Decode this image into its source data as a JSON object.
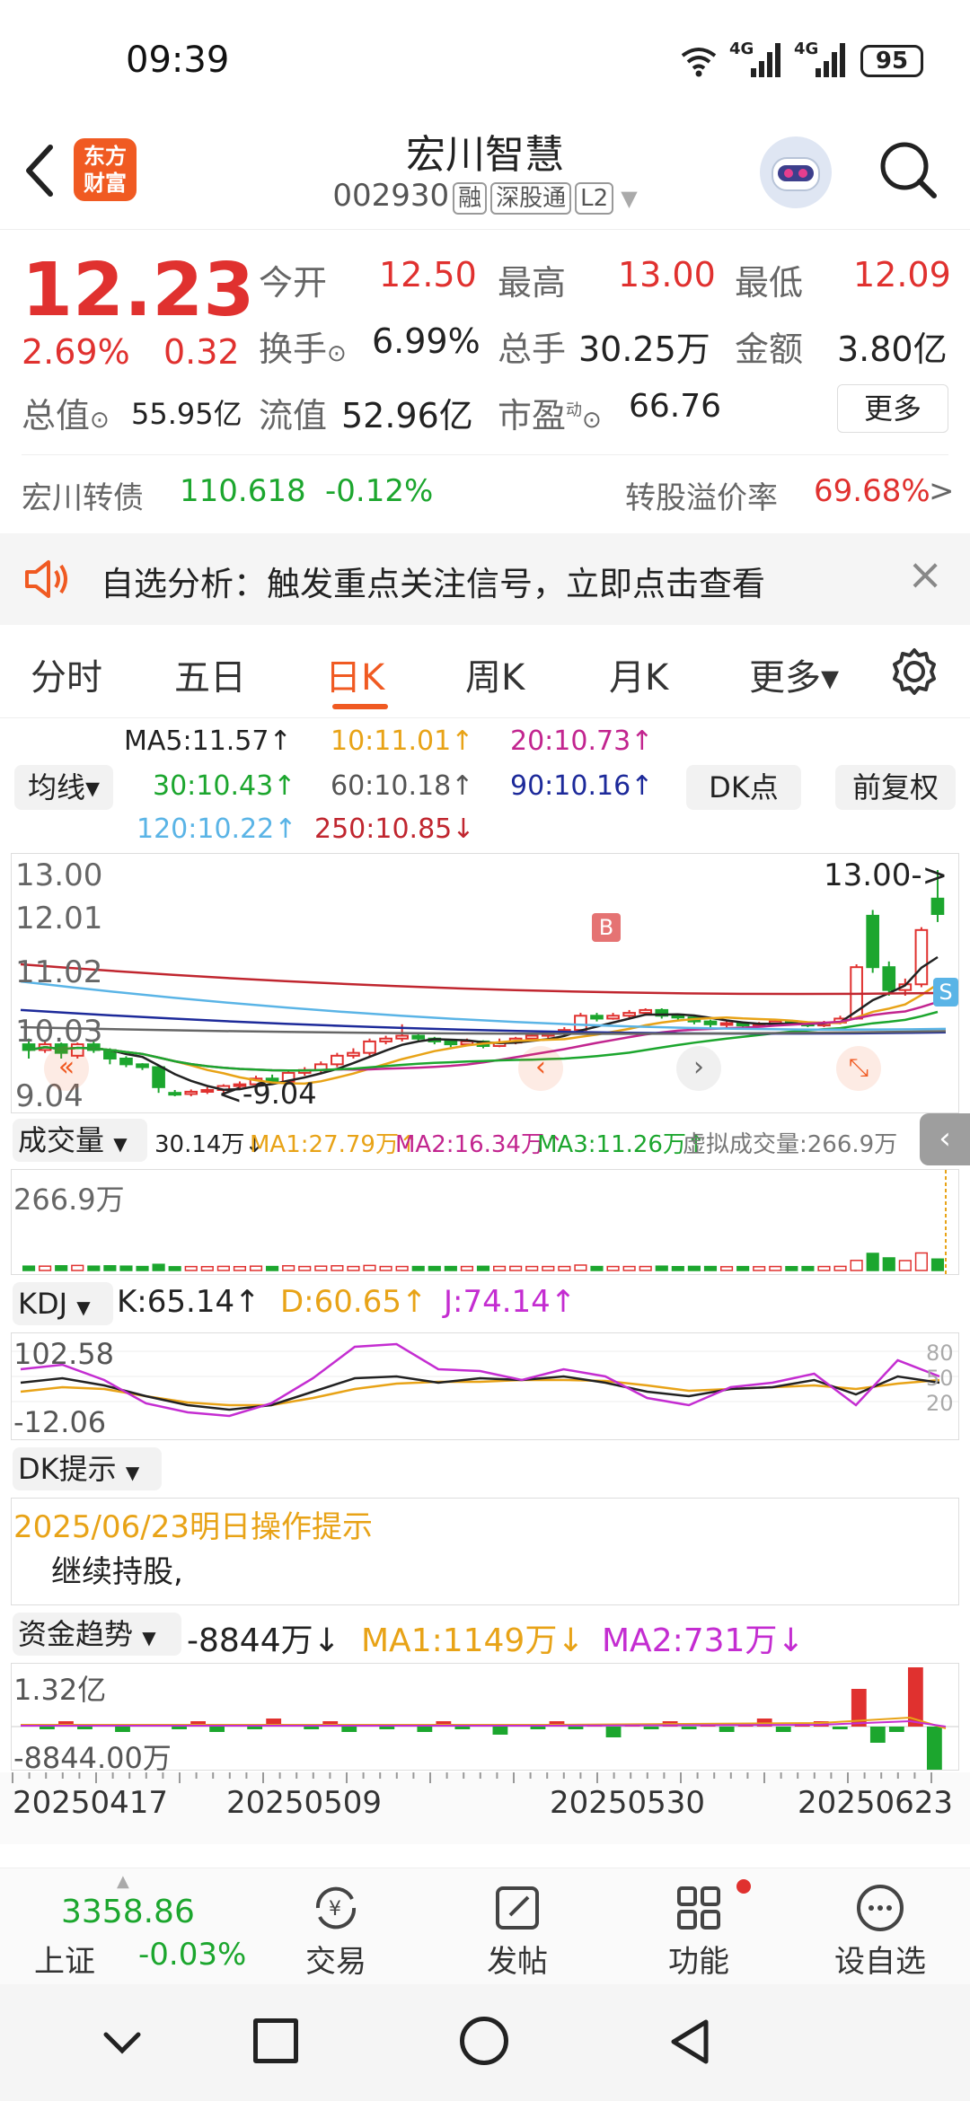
{
  "status": {
    "time": "09:39",
    "net1": "4G",
    "net2": "4G",
    "battery": "95"
  },
  "header": {
    "logo_line1": "东方",
    "logo_line2": "财富",
    "title": "宏川智慧",
    "code": "002930",
    "badges": [
      "融",
      "深股通",
      "L2"
    ]
  },
  "quote": {
    "price": "12.23",
    "pct": "2.69%",
    "chg": "0.32",
    "open_label": "今开",
    "open": "12.50",
    "high_label": "最高",
    "high": "13.00",
    "low_label": "最低",
    "low": "12.09",
    "turnover_label": "换手",
    "turnover": "6.99%",
    "volume_label": "总手",
    "volume": "30.25万",
    "amount_label": "金额",
    "amount": "3.80亿",
    "mcap_label": "总值",
    "mcap": "55.95亿",
    "float_label": "流值",
    "float": "52.96亿",
    "pe_label": "市盈",
    "pe_sup": "动",
    "pe": "66.76",
    "more_label": "更多"
  },
  "bond": {
    "name": "宏川转债",
    "price": "110.618",
    "pct": "-0.12%",
    "premium_label": "转股溢价率",
    "premium": "69.68%",
    "arrow": ">"
  },
  "notice": {
    "text": "自选分析：触发重点关注信号，立即点击查看",
    "close": "×"
  },
  "tabs": [
    "分时",
    "五日",
    "日K",
    "周K",
    "月K",
    "更多▾"
  ],
  "ma": {
    "selector": "均线▾",
    "ma5": "MA5:11.57↑",
    "ma10": "10:11.01↑",
    "ma20": "20:10.73↑",
    "ma30": "30:10.43↑",
    "ma60": "60:10.18↑",
    "ma90": "90:10.16↑",
    "ma120": "120:10.22↑",
    "ma250": "250:10.85↓",
    "dk": "DK点",
    "adj": "前复权",
    "colors": {
      "ma5": "#222222",
      "ma10": "#e8a317",
      "ma20": "#c2258f",
      "ma30": "#1ca62e",
      "ma60": "#666666",
      "ma90": "#1d2a9a",
      "ma120": "#5ab4e6",
      "ma250": "#c0262f"
    }
  },
  "kline": {
    "y_labels": [
      "13.00",
      "12.01",
      "11.02",
      "10.03",
      "9.04"
    ],
    "high_note": "13.00->",
    "low_note": "<-9.04",
    "b_marker": "B",
    "s_marker": "S",
    "candles": [
      {
        "o": 9.95,
        "c": 9.85,
        "h": 10.05,
        "l": 9.7
      },
      {
        "o": 9.85,
        "c": 9.95,
        "h": 10.0,
        "l": 9.8
      },
      {
        "o": 9.95,
        "c": 9.8,
        "h": 9.98,
        "l": 9.7
      },
      {
        "o": 9.75,
        "c": 9.95,
        "h": 9.98,
        "l": 9.7
      },
      {
        "o": 9.95,
        "c": 9.85,
        "h": 10.0,
        "l": 9.8
      },
      {
        "o": 9.85,
        "c": 9.7,
        "h": 9.88,
        "l": 9.6
      },
      {
        "o": 9.7,
        "c": 9.6,
        "h": 9.74,
        "l": 9.55
      },
      {
        "o": 9.6,
        "c": 9.55,
        "h": 9.62,
        "l": 9.5
      },
      {
        "o": 9.55,
        "c": 9.2,
        "h": 9.56,
        "l": 9.1
      },
      {
        "o": 9.1,
        "c": 9.08,
        "h": 9.15,
        "l": 9.04
      },
      {
        "o": 9.08,
        "c": 9.12,
        "h": 9.16,
        "l": 9.04
      },
      {
        "o": 9.12,
        "c": 9.15,
        "h": 9.2,
        "l": 9.08
      },
      {
        "o": 9.15,
        "c": 9.22,
        "h": 9.25,
        "l": 9.1
      },
      {
        "o": 9.22,
        "c": 9.25,
        "h": 9.3,
        "l": 9.18
      },
      {
        "o": 9.25,
        "c": 9.35,
        "h": 9.4,
        "l": 9.2
      },
      {
        "o": 9.35,
        "c": 9.3,
        "h": 9.42,
        "l": 9.25
      },
      {
        "o": 9.3,
        "c": 9.45,
        "h": 9.5,
        "l": 9.28
      },
      {
        "o": 9.45,
        "c": 9.5,
        "h": 9.55,
        "l": 9.4
      },
      {
        "o": 9.5,
        "c": 9.6,
        "h": 9.65,
        "l": 9.45
      },
      {
        "o": 9.6,
        "c": 9.75,
        "h": 9.8,
        "l": 9.55
      },
      {
        "o": 9.75,
        "c": 9.8,
        "h": 9.88,
        "l": 9.7
      },
      {
        "o": 9.8,
        "c": 10.0,
        "h": 10.05,
        "l": 9.75
      },
      {
        "o": 10.0,
        "c": 10.05,
        "h": 10.1,
        "l": 9.95
      },
      {
        "o": 10.05,
        "c": 10.1,
        "h": 10.3,
        "l": 10.0
      },
      {
        "o": 10.1,
        "c": 10.05,
        "h": 10.15,
        "l": 10.0
      },
      {
        "o": 10.05,
        "c": 10.0,
        "h": 10.08,
        "l": 9.95
      },
      {
        "o": 10.0,
        "c": 9.95,
        "h": 10.02,
        "l": 9.9
      },
      {
        "o": 9.95,
        "c": 10.0,
        "h": 10.05,
        "l": 9.92
      },
      {
        "o": 10.0,
        "c": 9.92,
        "h": 10.02,
        "l": 9.88
      },
      {
        "o": 9.92,
        "c": 9.98,
        "h": 10.05,
        "l": 9.9
      },
      {
        "o": 9.98,
        "c": 10.05,
        "h": 10.08,
        "l": 9.95
      },
      {
        "o": 10.05,
        "c": 10.1,
        "h": 10.12,
        "l": 10.0
      },
      {
        "o": 10.1,
        "c": 10.15,
        "h": 10.18,
        "l": 10.05
      },
      {
        "o": 10.15,
        "c": 10.2,
        "h": 10.25,
        "l": 10.1
      },
      {
        "o": 10.2,
        "c": 10.45,
        "h": 10.5,
        "l": 10.18
      },
      {
        "o": 10.45,
        "c": 10.4,
        "h": 10.5,
        "l": 10.35
      },
      {
        "o": 10.4,
        "c": 10.45,
        "h": 10.5,
        "l": 10.38
      },
      {
        "o": 10.45,
        "c": 10.5,
        "h": 10.55,
        "l": 10.4
      },
      {
        "o": 10.5,
        "c": 10.55,
        "h": 10.58,
        "l": 10.45
      },
      {
        "o": 10.55,
        "c": 10.45,
        "h": 10.58,
        "l": 10.4
      },
      {
        "o": 10.45,
        "c": 10.42,
        "h": 10.48,
        "l": 10.38
      },
      {
        "o": 10.42,
        "c": 10.35,
        "h": 10.45,
        "l": 10.3
      },
      {
        "o": 10.35,
        "c": 10.3,
        "h": 10.38,
        "l": 10.25
      },
      {
        "o": 10.3,
        "c": 10.32,
        "h": 10.36,
        "l": 10.25
      },
      {
        "o": 10.32,
        "c": 10.28,
        "h": 10.35,
        "l": 10.22
      },
      {
        "o": 10.28,
        "c": 10.3,
        "h": 10.34,
        "l": 10.25
      },
      {
        "o": 10.3,
        "c": 10.35,
        "h": 10.38,
        "l": 10.28
      },
      {
        "o": 10.35,
        "c": 10.32,
        "h": 10.38,
        "l": 10.28
      },
      {
        "o": 10.32,
        "c": 10.28,
        "h": 10.35,
        "l": 10.25
      },
      {
        "o": 10.28,
        "c": 10.33,
        "h": 10.36,
        "l": 10.25
      },
      {
        "o": 10.33,
        "c": 10.4,
        "h": 10.45,
        "l": 10.3
      },
      {
        "o": 10.4,
        "c": 11.3,
        "h": 11.35,
        "l": 10.38
      },
      {
        "o": 12.2,
        "c": 11.3,
        "h": 12.3,
        "l": 11.2
      },
      {
        "o": 11.3,
        "c": 10.9,
        "h": 11.4,
        "l": 10.8
      },
      {
        "o": 10.9,
        "c": 11.0,
        "h": 11.1,
        "l": 10.8
      },
      {
        "o": 11.0,
        "c": 11.95,
        "h": 12.0,
        "l": 10.95
      },
      {
        "o": 12.5,
        "c": 12.23,
        "h": 13.0,
        "l": 12.09
      }
    ]
  },
  "volume": {
    "selector": "成交量",
    "value": "30.14万↓",
    "ma1": "MA1:27.79万↑",
    "ma2": "MA2:16.34万↑",
    "ma3": "MA3:11.26万↑",
    "virtual": "虚拟成交量:266.9万",
    "y_label": "266.9万"
  },
  "kdj": {
    "selector": "KDJ",
    "k": "K:65.14↑",
    "d": "D:60.65↑",
    "j": "J:74.14↑",
    "y_top": "102.58",
    "y_bottom": "-12.06",
    "levels": [
      "80",
      "50",
      "20"
    ]
  },
  "dk": {
    "selector": "DK提示",
    "date_line": "2025/06/23明日操作提示",
    "advice": "继续持股,"
  },
  "fund": {
    "selector": "资金趋势",
    "value": "-8844万↓",
    "ma1": "MA1:1149万↓",
    "ma2": "MA2:731万↓",
    "y_top": "1.32亿",
    "y_bottom": "-8844.00万"
  },
  "dates": [
    "20250417",
    "20250509",
    "20250530",
    "20250623"
  ],
  "bottom_nav": {
    "index_value": "3358.86",
    "index_name": "上证",
    "index_pct": "-0.03%",
    "items": [
      "交易",
      "发帖",
      "功能",
      "设自选"
    ]
  }
}
